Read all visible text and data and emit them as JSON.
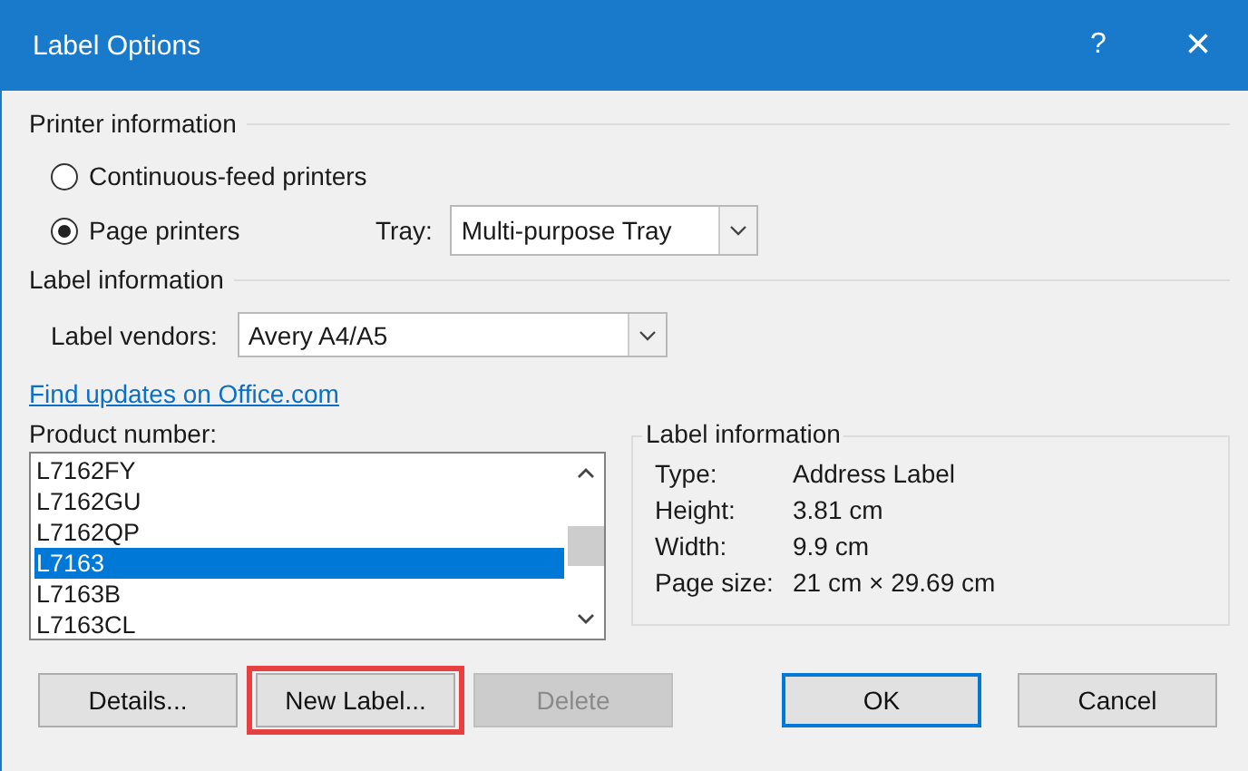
{
  "window": {
    "title": "Label Options",
    "help": "?",
    "close": "×"
  },
  "printer_information": {
    "title": "Printer information",
    "options": [
      {
        "label": "Continuous-feed printers",
        "selected": false
      },
      {
        "label": "Page printers",
        "selected": true
      }
    ],
    "tray": {
      "label": "Tray:",
      "value": "Multi-purpose Tray"
    }
  },
  "label_information": {
    "title": "Label information",
    "vendors": {
      "label": "Label vendors:",
      "value": "Avery A4/A5"
    }
  },
  "link": "Find updates on Office.com",
  "product_number": {
    "label": "Product number:",
    "items": [
      {
        "label": "L7162FY",
        "selected": false
      },
      {
        "label": "L7162GU",
        "selected": false
      },
      {
        "label": "L7162QP",
        "selected": false
      },
      {
        "label": "L7163",
        "selected": true
      },
      {
        "label": "L7163B",
        "selected": false
      },
      {
        "label": "L7163CL",
        "selected": false
      }
    ]
  },
  "details": {
    "title": "Label information",
    "rows": [
      {
        "key": "Type:",
        "value": "Address Label"
      },
      {
        "key": "Height:",
        "value": "3.81 cm"
      },
      {
        "key": "Width:",
        "value": "9.9 cm"
      },
      {
        "key": "Page size:",
        "value": "21 cm × 29.69 cm"
      }
    ]
  },
  "buttons": [
    {
      "label": "Details...",
      "disabled": false,
      "highlighted": false,
      "default": false
    },
    {
      "label": "New Label...",
      "disabled": false,
      "highlighted": true,
      "default": false
    },
    {
      "label": "Delete",
      "disabled": true,
      "highlighted": false,
      "default": false
    },
    {
      "label": "OK",
      "disabled": false,
      "highlighted": false,
      "default": true
    },
    {
      "label": "Cancel",
      "disabled": false,
      "highlighted": false,
      "default": false
    }
  ]
}
